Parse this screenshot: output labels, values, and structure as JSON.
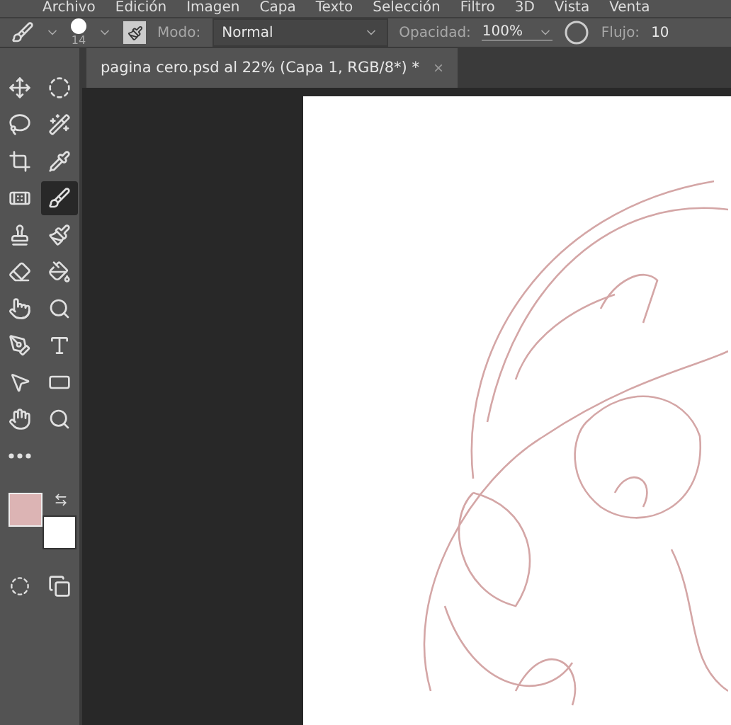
{
  "menu": [
    "Archivo",
    "Edición",
    "Imagen",
    "Capa",
    "Texto",
    "Selección",
    "Filtro",
    "3D",
    "Vista",
    "Venta"
  ],
  "options_bar": {
    "brush_size": "14",
    "mode_label": "Modo:",
    "mode_value": "Normal",
    "opacity_label": "Opacidad:",
    "opacity_value": "100%",
    "flow_label": "Flujo:",
    "flow_value": "10"
  },
  "document_tab": {
    "title": "pagina cero.psd al 22% (Capa 1, RGB/8*) *",
    "close": "×"
  },
  "tools": [
    {
      "kind": "move",
      "selected": false
    },
    {
      "kind": "marquee",
      "selected": false
    },
    {
      "kind": "lasso",
      "selected": false
    },
    {
      "kind": "wand",
      "selected": false
    },
    {
      "kind": "crop",
      "selected": false
    },
    {
      "kind": "eyedropper",
      "selected": false
    },
    {
      "kind": "healing",
      "selected": false
    },
    {
      "kind": "brush",
      "selected": true
    },
    {
      "kind": "stamp",
      "selected": false
    },
    {
      "kind": "history",
      "selected": false
    },
    {
      "kind": "eraser",
      "selected": false
    },
    {
      "kind": "bucket",
      "selected": false
    },
    {
      "kind": "smudge",
      "selected": false
    },
    {
      "kind": "dodge",
      "selected": false
    },
    {
      "kind": "pen",
      "selected": false
    },
    {
      "kind": "type",
      "selected": false
    },
    {
      "kind": "path",
      "selected": false
    },
    {
      "kind": "shape",
      "selected": false
    },
    {
      "kind": "hand",
      "selected": false
    },
    {
      "kind": "zoom",
      "selected": false
    },
    {
      "kind": "more",
      "selected": false
    }
  ]
}
